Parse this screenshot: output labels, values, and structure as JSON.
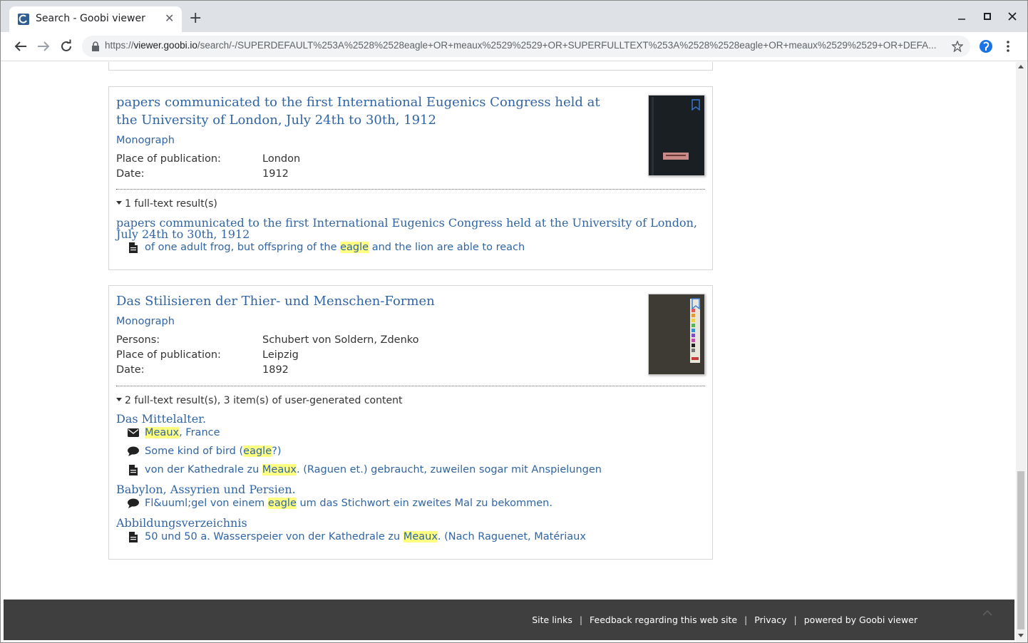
{
  "browser": {
    "tab_title": "Search - Goobi viewer",
    "tab_close": "✕",
    "new_tab": "+",
    "url_scheme": "https://",
    "url_host": "viewer.goobi.io",
    "url_path": "/search/-/SUPERDEFAULT%253A%2528%2528eagle+OR+meaux%2529%2529+OR+SUPERFULLTEXT%253A%2528%2528eagle+OR+meaux%2529%2529+OR+DEFA...",
    "icons": [
      "favicon",
      "back-icon",
      "forward-icon",
      "reload-icon",
      "lock-icon",
      "star-icon",
      "extension-icon",
      "menu-icon",
      "minimize-icon",
      "maximize-icon",
      "close-icon"
    ]
  },
  "results": [
    {
      "title_line1": "papers communicated to the first International Eugenics Congress held at",
      "title_line2": "the University of London, July 24th to 30th, 1912",
      "doctype": "Monograph",
      "meta": [
        {
          "label": "Place of publication:",
          "value": "London"
        },
        {
          "label": "Date:",
          "value": "1912"
        }
      ],
      "fulltext_toggle": "1 full-text result(s)",
      "groups": [
        {
          "heading": "papers communicated to the first International Eugenics Congress held at the University of London, July 24th to 30th, 1912",
          "hits": [
            {
              "icon": "document-icon",
              "before": "of one adult frog, but offspring of the ",
              "match": "eagle",
              "after": " and the lion are able to reach"
            }
          ]
        }
      ]
    },
    {
      "title_line1": "Das Stilisieren der Thier- und Menschen-Formen",
      "doctype": "Monograph",
      "meta": [
        {
          "label": "Persons:",
          "value": "Schubert von Soldern, Zdenko"
        },
        {
          "label": "Place of publication:",
          "value": "Leipzig"
        },
        {
          "label": "Date:",
          "value": "1892"
        }
      ],
      "fulltext_toggle": "2 full-text result(s), 3 item(s) of user-generated content",
      "groups": [
        {
          "heading": "Das Mittelalter.",
          "hits": [
            {
              "icon": "envelope-icon",
              "before": "",
              "match": "Meaux",
              "after": ", France"
            },
            {
              "icon": "comment-icon",
              "before": "Some kind of bird (",
              "match": "eagle",
              "after": "?)"
            },
            {
              "icon": "document-icon",
              "before": "von der Kathedrale zu ",
              "match": "Meaux",
              "after": ". (Raguen et.) gebraucht, zuweilen sogar mit Anspielungen"
            }
          ]
        },
        {
          "heading": "Babylon, Assyrien und Persien.",
          "hits": [
            {
              "icon": "comment-icon",
              "before": "Fl&uuml;gel von einem ",
              "match": "eagle",
              "after": " um das Stichwort ein zweites Mal zu bekommen."
            }
          ]
        },
        {
          "heading": "Abbildungsverzeichnis",
          "hits": [
            {
              "icon": "document-icon",
              "before": "50 und 50 a. Wasserspeier von der Kathedrale zu ",
              "match": "Meaux",
              "after": ". (Nach Raguenet, Matériaux"
            }
          ]
        }
      ]
    }
  ],
  "footer": {
    "links": [
      "Site links",
      "Feedback regarding this web site",
      "Privacy",
      "powered by Goobi viewer"
    ],
    "separator": "|"
  },
  "colors": {
    "link": "#3065a5",
    "highlight": "#ffff80",
    "footer_bg": "#3f3f3f"
  }
}
